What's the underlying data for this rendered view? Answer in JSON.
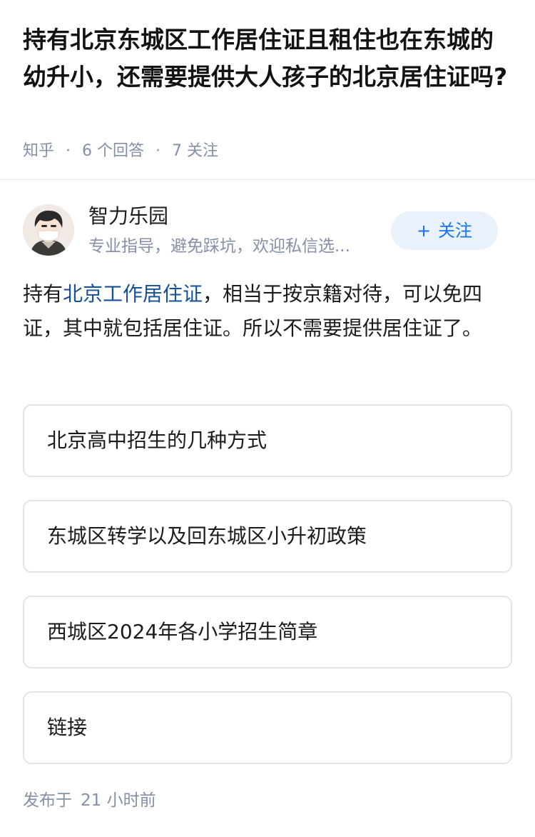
{
  "question": {
    "title": "持有北京东城区工作居住证且租住也在东城的幼升小，还需要提供大人孩子的北京居住证吗?",
    "source": "知乎",
    "separator": "·",
    "answers_count": "6 个回答",
    "followers_count": "7 关注"
  },
  "author": {
    "name": "智力乐园",
    "bio": "专业指导，避免踩坑，欢迎私信选...",
    "follow_plus": "+",
    "follow_label": "关注",
    "avatar_icon": "avatar-cartoon-boy-mask"
  },
  "answer": {
    "prefix": "持有",
    "link_text": "北京工作居住证",
    "suffix": "，相当于按京籍对待，可以免四证，其中就包括居住证。所以不需要提供居住证了。"
  },
  "link_cards": [
    {
      "label": "北京高中招生的几种方式"
    },
    {
      "label": "东城区转学以及回东城区小升初政策"
    },
    {
      "label": "西城区2024年各小学招生简章"
    },
    {
      "label": "链接"
    }
  ],
  "footer": {
    "publish_prefix": "发布于",
    "publish_time": "21 小时前"
  },
  "colors": {
    "accent": "#1772f6",
    "link": "#175199",
    "meta": "#8590a6",
    "follow_bg": "#e9f1fb"
  }
}
